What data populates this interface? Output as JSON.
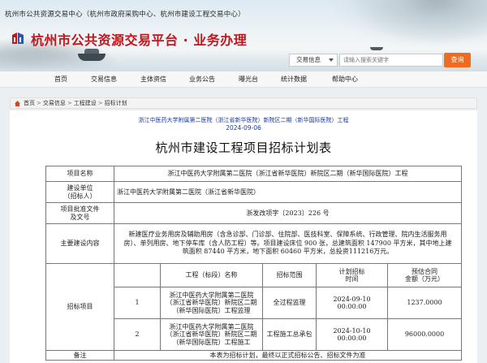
{
  "header": {
    "top_text": "杭州市公共资源交易中心（杭州市政府采购中心、杭州市建设工程交易中心）",
    "site_title": "杭州市公共资源交易平台 · 业务办理",
    "search": {
      "select_value": "交易信息",
      "placeholder": "请输入搜索关键字",
      "button_label": "查询"
    }
  },
  "nav": {
    "items": [
      "首页",
      "交易信息",
      "主体资信",
      "业务公告",
      "曝光台",
      "统计数据",
      "帮助中心"
    ]
  },
  "breadcrumb": [
    "首页",
    "交易信息",
    "工程建设",
    "招标计划"
  ],
  "page": {
    "project_subtitle": "浙江中医药大学附属第二医院（浙江省新华医院）新院区二期（新华国际医院）工程",
    "date": "2024-09-06",
    "doc_title": "杭州市建设工程项目招标计划表"
  },
  "table": {
    "project_name_label": "项目名称",
    "project_name_value": "浙江中医药大学附属第二医院（浙江省新华医院）新院区二期（新华国际医院）工程",
    "unit_label_1": "建设单位",
    "unit_label_2": "（招标人）",
    "unit_value": "浙江中医药大学附属第二医院（浙江省新华医院）",
    "approval_label_1": "项目批准文件",
    "approval_label_2": "及文号",
    "approval_value": "浙发改项字〔2023〕226 号",
    "content_label": "主要建设内容",
    "content_value": "新建医疗业务用房及辅助用房（含急诊部、门诊部、住院部、医技科室、保障系统、行政管理、院内生活服务用房）、单列用房、地下停车库（含人防工程）等。项目建设床位 900 张，总建筑面积 147900 平方米，其中地上建筑面积 87440 平方米，地下面积 60460 平方米，总投资111216万元。",
    "bid_items_label": "招标项目",
    "col_headers": {
      "name": "工程（标段）名称",
      "scope": "招标范围",
      "time_1": "计划招标",
      "time_2": "时间",
      "amount_1": "预估合同",
      "amount_2": "金额（万元）"
    },
    "rows": [
      {
        "index": "1",
        "name": "浙江中医药大学附属第二医院（浙江省新华医院）新院区二期（新华国际医院）工程监理",
        "scope": "全过程监理",
        "time": "2024-09-10 00:00:00",
        "amount": "1237.0000"
      },
      {
        "index": "2",
        "name": "浙江中医药大学附属第二医院（浙江省新华医院）新院区二期（新华国际医院）工程施工",
        "scope": "工程施工总承包",
        "time": "2024-10-10 00:00:00",
        "amount": "96000.0000"
      }
    ],
    "remarks_label": "备注",
    "remarks_value": "本表为招标计划，最终以正式招标公告、招标文件为准"
  },
  "colors": {
    "brand_red": "#c3161c",
    "search_button": "#f06b1d",
    "link_blue": "#1c3a9d"
  }
}
